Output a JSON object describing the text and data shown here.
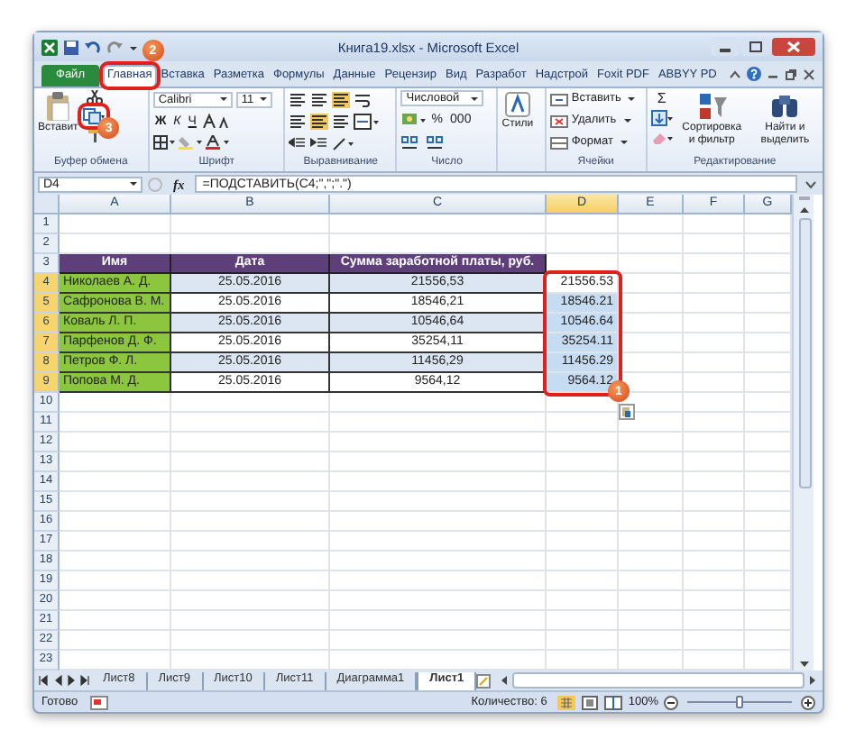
{
  "window": {
    "title": "Книга19.xlsx - Microsoft Excel"
  },
  "ribbon_tabs": [
    {
      "label": "Файл",
      "kind": "file",
      "selected": false,
      "highlighted": false
    },
    {
      "label": "Главная",
      "kind": "tab",
      "selected": true,
      "highlighted": true,
      "badge": "2"
    },
    {
      "label": "Вставка",
      "kind": "tab",
      "selected": false,
      "highlighted": false
    },
    {
      "label": "Разметка",
      "kind": "tab",
      "selected": false,
      "highlighted": false
    },
    {
      "label": "Формулы",
      "kind": "tab",
      "selected": false,
      "highlighted": false
    },
    {
      "label": "Данные",
      "kind": "tab",
      "selected": false,
      "highlighted": false
    },
    {
      "label": "Рецензир",
      "kind": "tab",
      "selected": false,
      "highlighted": false
    },
    {
      "label": "Вид",
      "kind": "tab",
      "selected": false,
      "highlighted": false
    },
    {
      "label": "Разработ",
      "kind": "tab",
      "selected": false,
      "highlighted": false
    },
    {
      "label": "Надстрой",
      "kind": "tab",
      "selected": false,
      "highlighted": false
    },
    {
      "label": "Foxit PDF",
      "kind": "tab",
      "selected": false,
      "highlighted": false
    },
    {
      "label": "ABBYY PD",
      "kind": "tab",
      "selected": false,
      "highlighted": false
    }
  ],
  "ribbon_groups": [
    {
      "kind": "clipboard",
      "label": "Буфер обмена",
      "paste": "Вставит",
      "copy_highlighted": true,
      "copy_badge": "3"
    },
    {
      "kind": "font",
      "label": "Шрифт",
      "font": "Calibri",
      "size": "11",
      "styles": [
        "Ж",
        "К",
        "Ч"
      ]
    },
    {
      "kind": "alignment",
      "label": "Выравнивание"
    },
    {
      "kind": "number",
      "label": "Число",
      "format": "Числовой",
      "buttons": [
        "%",
        "000"
      ]
    },
    {
      "kind": "styles",
      "button": "Стили"
    },
    {
      "kind": "cells",
      "label": "Ячейки",
      "buttons": [
        "Вставить",
        "Удалить",
        "Формат"
      ]
    },
    {
      "kind": "editing",
      "label": "Редактирование",
      "sum": "Σ",
      "buttons": [
        "Сортировка и фильтр",
        "Найти и выделить"
      ]
    }
  ],
  "formula_bar": {
    "cell": "D4",
    "fx": "fx",
    "formula": "=ПОДСТАВИТЬ(C4;\",\";\".\")"
  },
  "columns": [
    {
      "label": "A",
      "selected": false
    },
    {
      "label": "B",
      "selected": false
    },
    {
      "label": "C",
      "selected": false
    },
    {
      "label": "D",
      "selected": true
    },
    {
      "label": "E",
      "selected": false
    },
    {
      "label": "F",
      "selected": false
    },
    {
      "label": "G",
      "selected": false
    }
  ],
  "rows": [
    {
      "number": "1",
      "selected": false
    },
    {
      "number": "2",
      "selected": false
    },
    {
      "number": "3",
      "selected": false,
      "cells": [
        {
          "kind": "header",
          "text": "Имя"
        },
        {
          "kind": "header",
          "text": "Дата"
        },
        {
          "kind": "header",
          "text": "Сумма заработной платы, руб."
        }
      ]
    },
    {
      "number": "4",
      "selected": true,
      "banded": true,
      "cells": [
        {
          "kind": "name",
          "text": "Николаев А. Д."
        },
        {
          "kind": "date",
          "text": "25.05.2016"
        },
        {
          "kind": "amount",
          "text": "21556,53"
        },
        {
          "kind": "result",
          "text": "21556.53",
          "selected": false
        }
      ]
    },
    {
      "number": "5",
      "selected": true,
      "banded": false,
      "cells": [
        {
          "kind": "name",
          "text": "Сафронова В. М."
        },
        {
          "kind": "date",
          "text": "25.05.2016"
        },
        {
          "kind": "amount",
          "text": "18546,21"
        },
        {
          "kind": "result",
          "text": "18546.21",
          "selected": true
        }
      ]
    },
    {
      "number": "6",
      "selected": true,
      "banded": true,
      "cells": [
        {
          "kind": "name",
          "text": "Коваль Л. П."
        },
        {
          "kind": "date",
          "text": "25.05.2016"
        },
        {
          "kind": "amount",
          "text": "10546,64"
        },
        {
          "kind": "result",
          "text": "10546.64",
          "selected": true
        }
      ]
    },
    {
      "number": "7",
      "selected": true,
      "banded": false,
      "cells": [
        {
          "kind": "name",
          "text": "Парфенов Д. Ф."
        },
        {
          "kind": "date",
          "text": "25.05.2016"
        },
        {
          "kind": "amount",
          "text": "35254,11"
        },
        {
          "kind": "result",
          "text": "35254.11",
          "selected": true
        }
      ]
    },
    {
      "number": "8",
      "selected": true,
      "banded": true,
      "cells": [
        {
          "kind": "name",
          "text": "Петров Ф. Л."
        },
        {
          "kind": "date",
          "text": "25.05.2016"
        },
        {
          "kind": "amount",
          "text": "11456,29"
        },
        {
          "kind": "result",
          "text": "11456.29",
          "selected": true
        }
      ]
    },
    {
      "number": "9",
      "selected": true,
      "banded": false,
      "cells": [
        {
          "kind": "name",
          "text": "Попова М. Д."
        },
        {
          "kind": "date",
          "text": "25.05.2016"
        },
        {
          "kind": "amount",
          "text": "9564,12"
        },
        {
          "kind": "result",
          "text": "9564.12",
          "selected": true,
          "paste_options": true
        }
      ]
    },
    {
      "number": "10",
      "selected": false
    },
    {
      "number": "11",
      "selected": false
    },
    {
      "number": "12",
      "selected": false
    },
    {
      "number": "13",
      "selected": false
    },
    {
      "number": "14",
      "selected": false
    },
    {
      "number": "15",
      "selected": false
    },
    {
      "number": "16",
      "selected": false
    },
    {
      "number": "17",
      "selected": false
    },
    {
      "number": "18",
      "selected": false
    },
    {
      "number": "19",
      "selected": false
    },
    {
      "number": "20",
      "selected": false
    },
    {
      "number": "21",
      "selected": false
    },
    {
      "number": "22",
      "selected": false
    },
    {
      "number": "23",
      "selected": false
    }
  ],
  "annotations": [
    {
      "kind": "result_frame",
      "badge": "1"
    }
  ],
  "sheet_tabs": [
    {
      "label": "Лист8",
      "selected": false
    },
    {
      "label": "Лист9",
      "selected": false
    },
    {
      "label": "Лист10",
      "selected": false
    },
    {
      "label": "Лист11",
      "selected": false
    },
    {
      "label": "Диаграмма1",
      "selected": false
    },
    {
      "label": "Лист1",
      "selected": true
    }
  ],
  "status_bar": {
    "ready": "Готово",
    "count": "Количество: 6",
    "zoom": "100%",
    "zoom_slider": {
      "level": 0.5
    }
  }
}
